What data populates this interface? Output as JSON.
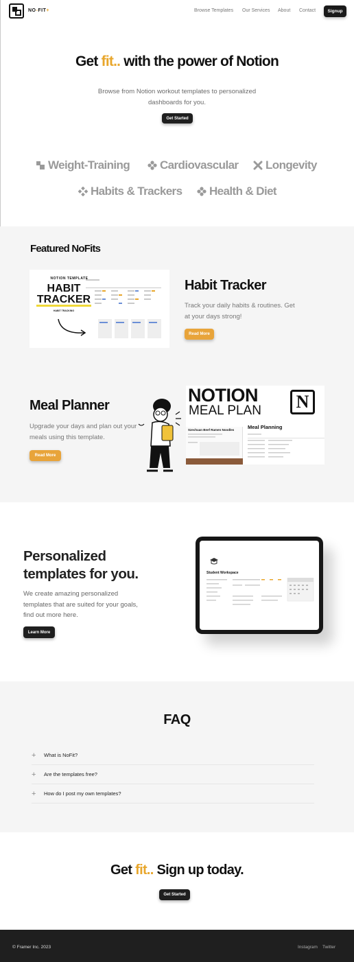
{
  "nav": {
    "logo_main": "NO",
    "logo_dash": "-",
    "logo_fit": "FIT",
    "logo_plus": "+",
    "links": [
      "Browse Templates",
      "Our Services",
      "About",
      "Contact"
    ],
    "signup": "Signup"
  },
  "hero": {
    "title_pre": "Get ",
    "title_fit": "fit..",
    "title_post": " with the power of Notion",
    "subtitle": "Browse from Notion workout templates to personalized dashboards for you.",
    "cta": "Get Started",
    "categories": [
      "Weight-Training",
      "Cardiovascular",
      "Longevity",
      "Habits & Trackers",
      "Health & Diet"
    ]
  },
  "featured": {
    "title": "Featured NoFits",
    "habit": {
      "card_small": "NOTION TEMPLATE",
      "card_big1": "HABIT",
      "card_big2": "TRACKER",
      "card_tag": "HABIT TRACKING",
      "title": "Habit Tracker",
      "desc": "Track your daily habits & routines. Get at your days strong!",
      "button": "Read More"
    },
    "meal": {
      "title": "Meal Planner",
      "desc": "Upgrade your days and plan out your meals using this template.",
      "button": "Read More",
      "card_line1": "NOTION",
      "card_line2": "MEAL PLAN",
      "card_logo": "N",
      "card_heading": "Meal Planning",
      "card_recipe": "Szechuan Beef Ramen Noodles"
    }
  },
  "personalized": {
    "title": "Personalized templates for you.",
    "desc": "We create amazing personalized templates that are suited for your goals, find out more here.",
    "button": "Learn More",
    "screen_title": "Student Workspace"
  },
  "faq": {
    "title": "FAQ",
    "items": [
      "What is NoFit?",
      "Are the templates free?",
      "How do I post my own templates?"
    ]
  },
  "cta": {
    "pre": "Get ",
    "fit": "fit..",
    "post": " Sign up today.",
    "button": "Get Started"
  },
  "footer": {
    "copyright": "© Framer Inc. 2023",
    "links": [
      "Instagram",
      "Twitter"
    ]
  },
  "colors": {
    "accent": "#e8a62b",
    "dark": "#1f1f1f",
    "panel": "#f5f5f5"
  }
}
